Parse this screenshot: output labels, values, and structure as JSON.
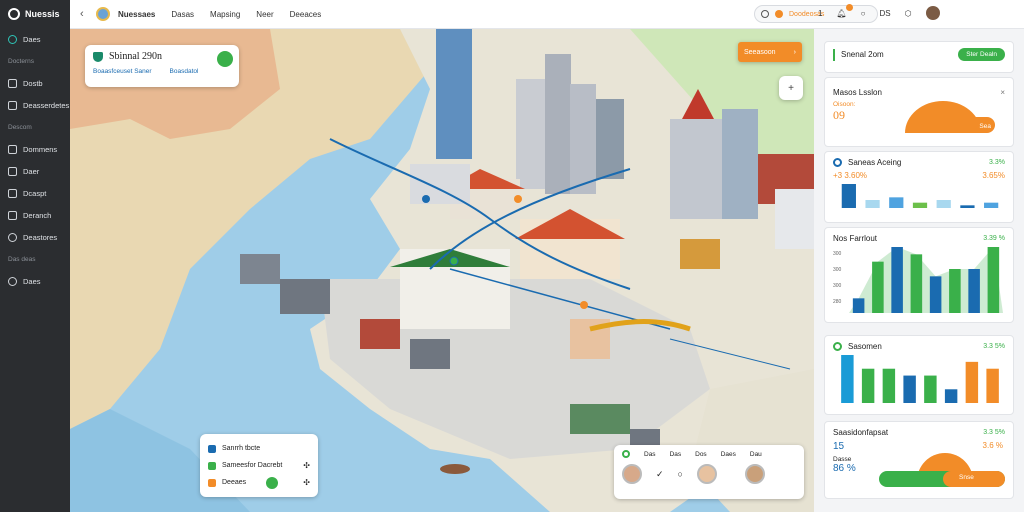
{
  "app": {
    "name": "Nuessis"
  },
  "sidebar": {
    "items": [
      {
        "label": "Daes",
        "icon": "compass-icon",
        "round": true,
        "active": true
      },
      {
        "section": "Docterns"
      },
      {
        "label": "Dostb",
        "icon": "phone-icon"
      },
      {
        "label": "Deasserdetes",
        "icon": "layers-icon"
      },
      {
        "section": "Descom"
      },
      {
        "label": "Dommens",
        "icon": "grid-icon"
      },
      {
        "label": "Daer",
        "icon": "chat-icon"
      },
      {
        "label": "Dcaspt",
        "icon": "doc-icon"
      },
      {
        "label": "Deranch",
        "icon": "folder-icon"
      },
      {
        "label": "Deastores",
        "icon": "refresh-icon",
        "round": true
      },
      {
        "section": "Das deas"
      },
      {
        "label": "Daes",
        "icon": "gear-icon",
        "round": true
      }
    ]
  },
  "topbar": {
    "nav": [
      {
        "label": "Nuessaes",
        "active": true
      },
      {
        "label": "Dasas"
      },
      {
        "label": "Mapsing"
      },
      {
        "label": "Neer"
      },
      {
        "label": "Deeaces"
      }
    ],
    "search_text": "Doodeosas",
    "icons": [
      "help-icon",
      "bell-icon",
      "globe-icon",
      "pin-icon",
      "shield-icon"
    ],
    "icon_labels": [
      "1",
      "",
      "",
      "DS",
      ""
    ],
    "bell_count": "2"
  },
  "map": {
    "location_title": "Sbinnal 290n",
    "location_links": [
      "Boaasfceuset Saner",
      "Boasdatol"
    ],
    "orange_chip": "Seeasoon",
    "plus": "+",
    "legend": [
      {
        "label": "Sanrrh tbcte",
        "color": "#1a6bb0",
        "action": ""
      },
      {
        "label": "Sameesfor Dacrebt",
        "color": "#3ab04a",
        "action": "✣"
      },
      {
        "label": "Deeaes",
        "color": "#f28c28",
        "action": "✣"
      }
    ],
    "people": {
      "tabs": [
        "Das",
        "Das",
        "Dos",
        "Daes",
        "Dau"
      ],
      "glyphs": [
        "✓",
        "○"
      ]
    }
  },
  "panels": {
    "top": {
      "title": "Snenal 2om",
      "button": "Ster Dealn",
      "icon": "chart-icon"
    },
    "gauge1": {
      "title": "Masos Lsslon",
      "value": "09",
      "prefix": "Oisoon:",
      "button": "Sea",
      "close": "×"
    },
    "bar1": {
      "title": "Saneas Aceing",
      "value_left": "+3 3.60%",
      "value_right": "3.65%",
      "corner": "3.3%"
    },
    "bar2": {
      "title": "Nos Farrlout",
      "value_right": "3.39 %",
      "yticks": [
        "300",
        "300",
        "300",
        "280"
      ],
      "xticks": [
        "320",
        "22",
        "10",
        "30",
        "30",
        "100"
      ]
    },
    "bar3": {
      "title": "Sasomen",
      "value_right": "3.3 5%"
    },
    "gauge2": {
      "title": "Saasidonfapsat",
      "value_right": "3.3 5%",
      "value_a": "15",
      "value_label": "Dasse",
      "value_b": "86 %",
      "value_c": "3.6 %",
      "button": "Snse"
    }
  },
  "chart_data": [
    {
      "type": "bar",
      "title": "Saneas Aceing",
      "values": [
        9,
        3,
        4,
        2,
        3,
        1,
        2
      ],
      "colors": [
        "#1a6bb0",
        "#a8d8ef",
        "#4fa3e0",
        "#6cc04a",
        "#a8d8ef",
        "#1a6bb0",
        "#4fa3e0"
      ]
    },
    {
      "type": "bar",
      "title": "Nos Farrlout",
      "values": [
        2,
        7,
        9,
        8,
        5,
        6,
        6,
        9
      ],
      "colors": [
        "#1a6bb0",
        "#3ab04a",
        "#1a6bb0",
        "#3ab04a",
        "#1a6bb0",
        "#3ab04a",
        "#1a6bb0",
        "#3ab04a"
      ]
    },
    {
      "type": "bar",
      "title": "Sasomen",
      "values": [
        7,
        5,
        5,
        4,
        4,
        2,
        6,
        5
      ],
      "colors": [
        "#1a9bd6",
        "#3ab04a",
        "#3ab04a",
        "#1a6bb0",
        "#3ab04a",
        "#1a6bb0",
        "#f28c28",
        "#f28c28"
      ]
    }
  ]
}
